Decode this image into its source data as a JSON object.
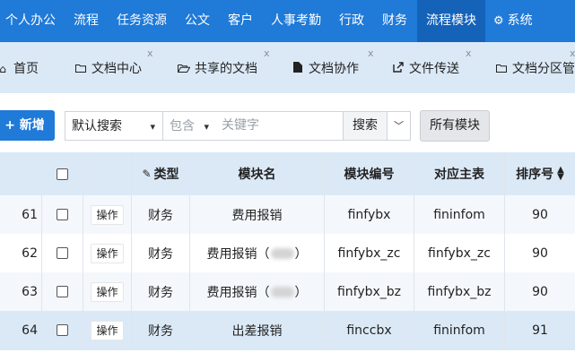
{
  "topnav": {
    "items": [
      {
        "label": "个人办公"
      },
      {
        "label": "流程"
      },
      {
        "label": "任务资源"
      },
      {
        "label": "公文"
      },
      {
        "label": "客户"
      },
      {
        "label": "人事考勤"
      },
      {
        "label": "行政"
      },
      {
        "label": "财务"
      },
      {
        "label": "流程模块",
        "active": true
      },
      {
        "label": "系统",
        "icon": "gear-icon"
      }
    ]
  },
  "tabs": [
    {
      "label": "首页",
      "icon": "home-icon"
    },
    {
      "label": "文档中心",
      "icon": "folder-icon",
      "close": "x"
    },
    {
      "label": "共享的文档",
      "icon": "folder-open-icon",
      "close": "x"
    },
    {
      "label": "文档协作",
      "icon": "document-icon",
      "close": "x"
    },
    {
      "label": "文件传送",
      "icon": "share-icon",
      "close": "x"
    },
    {
      "label": "文档分区管",
      "icon": "folder-icon",
      "close": "x"
    }
  ],
  "toolbar": {
    "add_label": "新增",
    "search_mode": "默认搜索",
    "match_mode": "包含",
    "keyword_placeholder": "关键字",
    "search_label": "搜索",
    "modules_label": "所有模块"
  },
  "table": {
    "headers": {
      "type": "类型",
      "name": "模块名",
      "code": "模块编号",
      "main_table": "对应主表",
      "sort": "排序号"
    },
    "op_label": "操作",
    "rows": [
      {
        "num": "61",
        "type": "财务",
        "name": "费用报销",
        "code": "finfybx",
        "main_table": "fininfom",
        "sort": "90"
      },
      {
        "num": "62",
        "type": "财务",
        "name": "费用报销（",
        "name_suffix": "）",
        "code": "finfybx_zc",
        "main_table": "finfybx_zc",
        "sort": "90"
      },
      {
        "num": "63",
        "type": "财务",
        "name": "费用报销（",
        "name_suffix": "）",
        "code": "finfybx_bz",
        "main_table": "finfybx_bz",
        "sort": "90"
      },
      {
        "num": "64",
        "type": "财务",
        "name": "出差报销",
        "code": "finccbx",
        "main_table": "fininfom",
        "sort": "91"
      }
    ]
  },
  "colors": {
    "nav_bg": "#1f7ad8",
    "nav_active": "#1562b9",
    "tabbar_bg": "#dbe9f7",
    "header_bg": "#dbe9f7",
    "row_alt_bg": "#f1f7fd"
  }
}
